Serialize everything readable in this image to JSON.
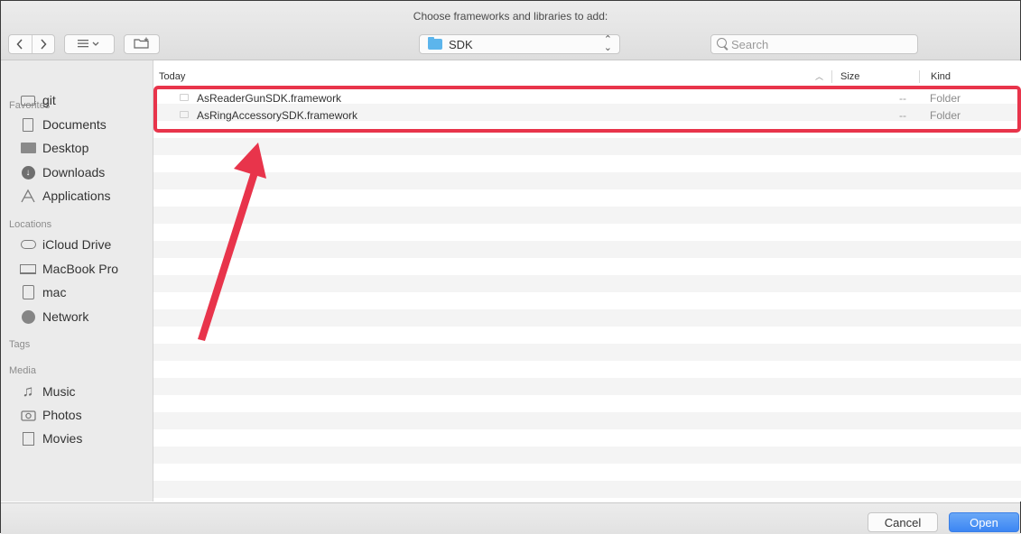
{
  "window": {
    "title": "Choose frameworks and libraries to add:"
  },
  "toolbar": {
    "back_icon": "chevron-left-icon",
    "forward_icon": "chevron-right-icon",
    "view_icon": "list-view-icon",
    "new_folder_icon": "new-folder-icon",
    "location": "SDK",
    "search_placeholder": "Search"
  },
  "sidebar": {
    "favorites_header": "Favorites",
    "favorites": [
      {
        "label": "git",
        "icon": "folder-icon"
      },
      {
        "label": "Documents",
        "icon": "documents-icon"
      },
      {
        "label": "Desktop",
        "icon": "desktop-icon"
      },
      {
        "label": "Downloads",
        "icon": "downloads-icon"
      },
      {
        "label": "Applications",
        "icon": "applications-icon"
      }
    ],
    "locations_header": "Locations",
    "locations": [
      {
        "label": "iCloud Drive",
        "icon": "cloud-icon"
      },
      {
        "label": "MacBook Pro",
        "icon": "laptop-icon"
      },
      {
        "label": "mac",
        "icon": "disk-icon"
      },
      {
        "label": "Network",
        "icon": "network-icon"
      }
    ],
    "tags_header": "Tags",
    "media_header": "Media",
    "media": [
      {
        "label": "Music",
        "icon": "music-icon"
      },
      {
        "label": "Photos",
        "icon": "photos-icon"
      },
      {
        "label": "Movies",
        "icon": "movies-icon"
      }
    ]
  },
  "file_list": {
    "columns": {
      "name": "Today",
      "size": "Size",
      "kind": "Kind"
    },
    "rows": [
      {
        "name": "AsReaderGunSDK.framework",
        "size": "--",
        "kind": "Folder"
      },
      {
        "name": "AsRingAccessorySDK.framework",
        "size": "--",
        "kind": "Folder"
      }
    ]
  },
  "annotation": {
    "highlight_color": "#e8344b"
  },
  "buttons": {
    "cancel": "Cancel",
    "open": "Open",
    "accent": "#3c86f3"
  }
}
